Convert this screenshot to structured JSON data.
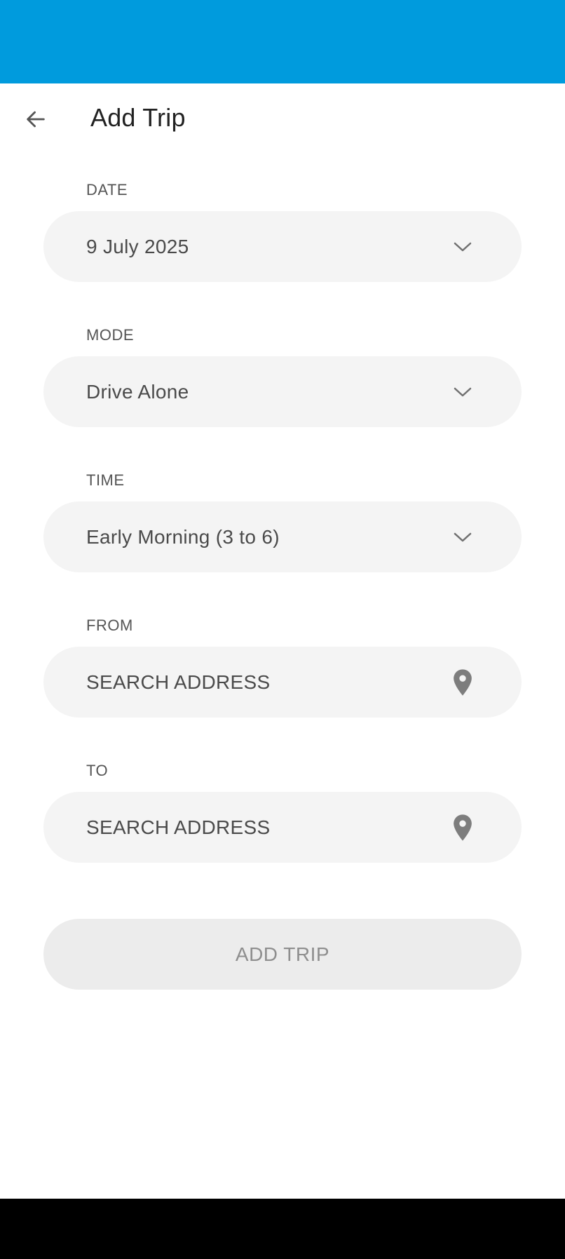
{
  "header": {
    "title": "Add Trip"
  },
  "icons": {
    "back": "arrow-left-icon",
    "dropdown": "chevron-down-icon",
    "location": "map-pin-icon"
  },
  "colors": {
    "status_bar": "#009bdd",
    "field_bg": "#f4f4f4",
    "button_bg": "#ececec",
    "button_text": "#8e8e8e"
  },
  "form": {
    "date": {
      "label": "DATE",
      "value": "9 July 2025"
    },
    "mode": {
      "label": "MODE",
      "value": "Drive Alone"
    },
    "time": {
      "label": "TIME",
      "value": "Early Morning (3 to 6)"
    },
    "from": {
      "label": "FROM",
      "placeholder": "SEARCH ADDRESS"
    },
    "to": {
      "label": "TO",
      "placeholder": "SEARCH ADDRESS"
    }
  },
  "actions": {
    "add_trip_label": "ADD TRIP"
  }
}
